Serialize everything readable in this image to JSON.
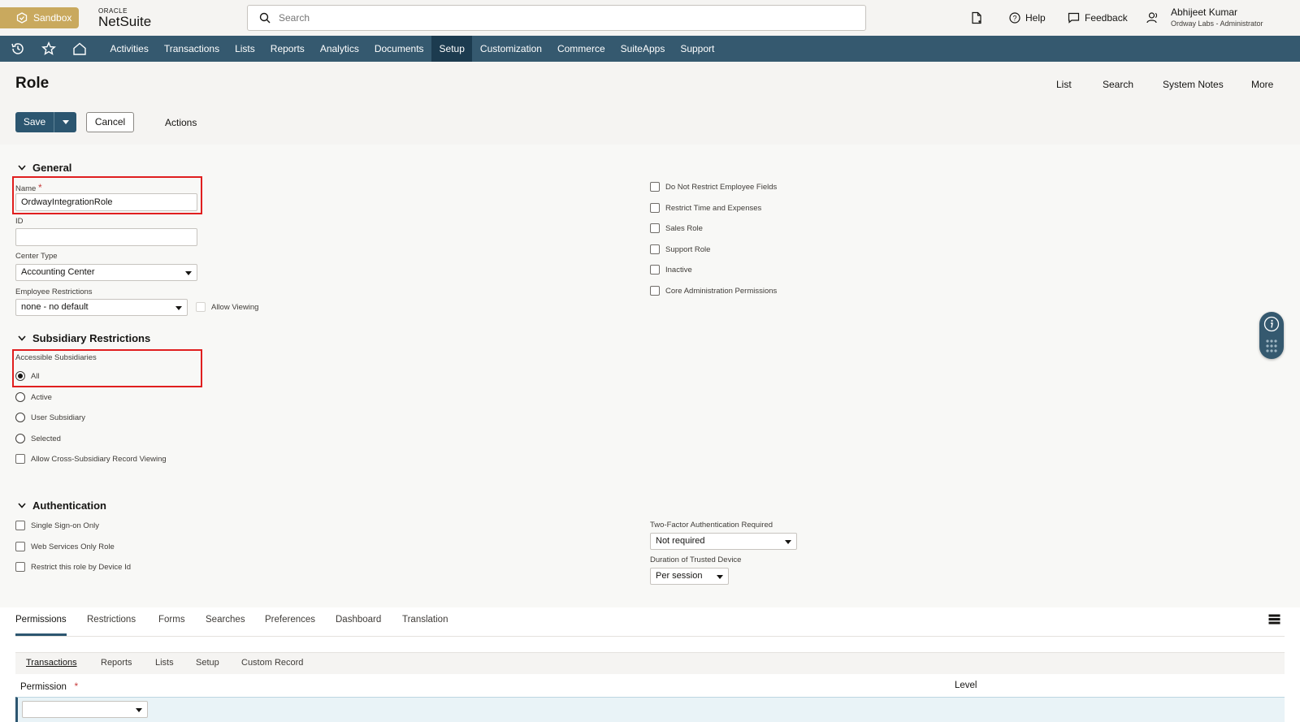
{
  "topbar": {
    "sandbox_label": "Sandbox",
    "logo_top": "ORACLE",
    "logo_main": "NetSuite",
    "search_placeholder": "Search",
    "help_label": "Help",
    "feedback_label": "Feedback",
    "user_name": "Abhijeet Kumar",
    "user_role": "Ordway Labs - Administrator"
  },
  "nav": {
    "items": [
      "Activities",
      "Transactions",
      "Lists",
      "Reports",
      "Analytics",
      "Documents",
      "Setup",
      "Customization",
      "Commerce",
      "SuiteApps",
      "Support"
    ],
    "active": "Setup"
  },
  "page": {
    "title": "Role",
    "links": [
      "List",
      "Search",
      "System Notes",
      "More"
    ],
    "save_label": "Save",
    "cancel_label": "Cancel",
    "actions_label": "Actions"
  },
  "general": {
    "title": "General",
    "name_label": "Name",
    "name_value": "OrdwayIntegrationRole",
    "id_label": "ID",
    "id_value": "",
    "center_type_label": "Center Type",
    "center_type_value": "Accounting Center",
    "employee_restrictions_label": "Employee Restrictions",
    "employee_restrictions_value": "none - no default",
    "allow_viewing_label": "Allow Viewing",
    "right_checkboxes": [
      "Do Not Restrict Employee Fields",
      "Restrict Time and Expenses",
      "Sales Role",
      "Support Role",
      "Inactive",
      "Core Administration Permissions"
    ]
  },
  "subsidiary": {
    "title": "Subsidiary Restrictions",
    "accessible_label": "Accessible Subsidiaries",
    "options": [
      "All",
      "Active",
      "User Subsidiary",
      "Selected"
    ],
    "selected": "All",
    "cross_label": "Allow Cross-Subsidiary Record Viewing"
  },
  "authentication": {
    "title": "Authentication",
    "checkboxes": [
      "Single Sign-on Only",
      "Web Services Only Role",
      "Restrict this role by Device Id"
    ],
    "twofa_label": "Two-Factor Authentication Required",
    "twofa_value": "Not required",
    "duration_label": "Duration of Trusted Device",
    "duration_value": "Per session"
  },
  "tabs": {
    "items": [
      "Permissions",
      "Restrictions",
      "Forms",
      "Searches",
      "Preferences",
      "Dashboard",
      "Translation"
    ],
    "active": "Permissions",
    "subtabs": [
      "Transactions",
      "Reports",
      "Lists",
      "Setup",
      "Custom Record"
    ],
    "active_subtab": "Transactions",
    "permission_header": "Permission",
    "level_header": "Level"
  },
  "colors": {
    "nav_bg": "#35596f",
    "nav_active": "#1c3b4f",
    "sandbox": "#c9a95e",
    "highlight_box": "#e01f1f",
    "primary_button": "#2c5670"
  }
}
